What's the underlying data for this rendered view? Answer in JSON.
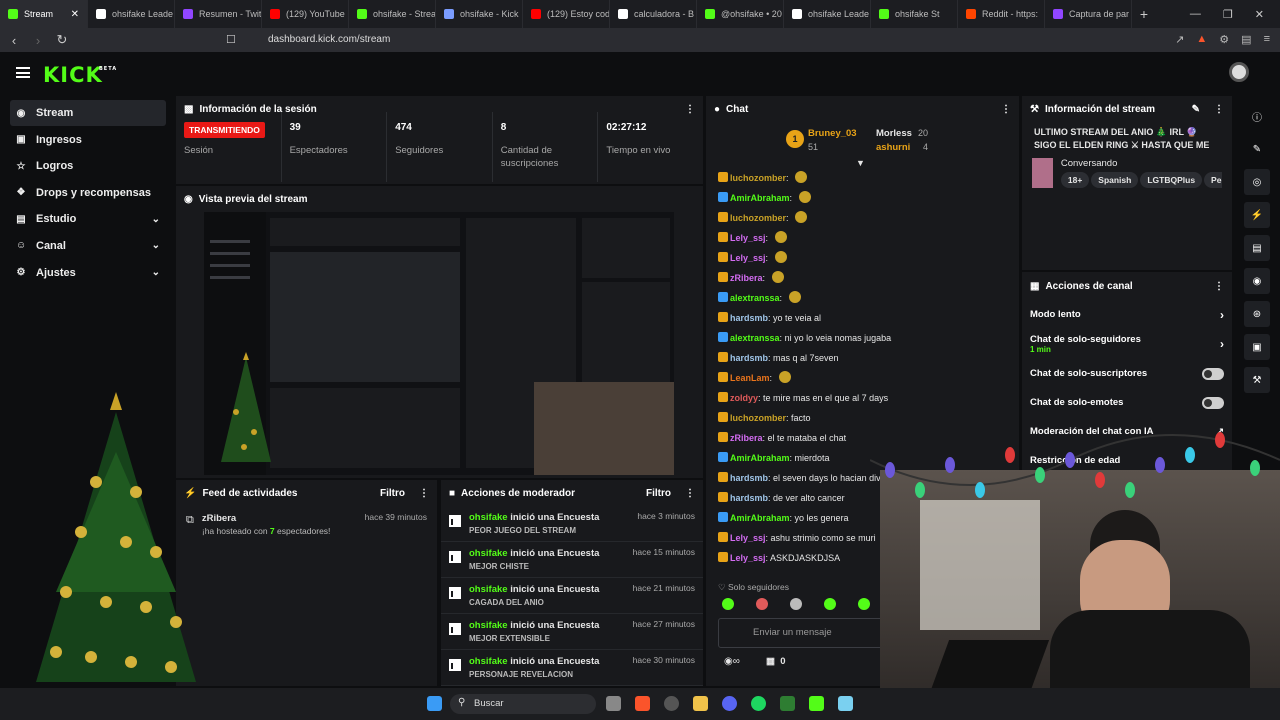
{
  "browser": {
    "tabs": [
      {
        "label": "Stream",
        "color": "#53fc18"
      },
      {
        "label": "ohsifake Leade",
        "color": "#ffffff"
      },
      {
        "label": "Resumen - Twit",
        "color": "#9146ff"
      },
      {
        "label": "(129) YouTube",
        "color": "#ff0000"
      },
      {
        "label": "ohsifake - Strea",
        "color": "#53fc18"
      },
      {
        "label": "ohsifake - Kick",
        "color": "#7a9cff"
      },
      {
        "label": "(129) Estoy cod",
        "color": "#ff0000"
      },
      {
        "label": "calculadora - B",
        "color": "#ffffff"
      },
      {
        "label": "@ohsifake • 20",
        "color": "#53fc18"
      },
      {
        "label": "ohsifake Leade",
        "color": "#ffffff"
      },
      {
        "label": "ohsifake St",
        "color": "#53fc18"
      },
      {
        "label": "Reddit - https:",
        "color": "#ff4500"
      },
      {
        "label": "Captura de par",
        "color": "#9146ff"
      }
    ],
    "url": "dashboard.kick.com/stream"
  },
  "brand": {
    "logo": "KICK",
    "beta": "BETA",
    "accent": "#53fc18"
  },
  "sidebar": {
    "items": [
      {
        "label": "Stream",
        "icon": "broadcast-icon"
      },
      {
        "label": "Ingresos",
        "icon": "money-icon"
      },
      {
        "label": "Logros",
        "icon": "trophy-icon"
      },
      {
        "label": "Drops y recompensas",
        "icon": "gift-icon"
      },
      {
        "label": "Estudio",
        "icon": "studio-icon"
      },
      {
        "label": "Canal",
        "icon": "user-icon"
      },
      {
        "label": "Ajustes",
        "icon": "gear-icon"
      }
    ]
  },
  "session": {
    "title": "Información de la sesión",
    "status": "TRANSMITIENDO",
    "status_label": "Sesión",
    "viewers": "39",
    "viewers_label": "Espectadores",
    "followers": "474",
    "followers_label": "Seguidores",
    "subs": "8",
    "subs_label": "Cantidad de suscripciones",
    "uptime": "02:27:12",
    "uptime_label": "Tiempo en vivo"
  },
  "preview": {
    "title": "Vista previa del stream"
  },
  "feed": {
    "title": "Feed de actividades",
    "filter": "Filtro",
    "user": "zRibera",
    "time": "hace 39 minutos",
    "msg_a": "¡ha hosteado con ",
    "msg_n": "7",
    "msg_b": " espectadores!"
  },
  "mod": {
    "title": "Acciones de moderador",
    "filter": "Filtro",
    "rows": [
      {
        "user": "ohsifake",
        "action": "inició una Encuesta",
        "sub": "PEOR JUEGO DEL STREAM",
        "time": "hace 3 minutos"
      },
      {
        "user": "ohsifake",
        "action": "inició una Encuesta",
        "sub": "MEJOR CHISTE",
        "time": "hace 15 minutos"
      },
      {
        "user": "ohsifake",
        "action": "inició una Encuesta",
        "sub": "CAGADA DEL ANIO",
        "time": "hace 21 minutos"
      },
      {
        "user": "ohsifake",
        "action": "inició una Encuesta",
        "sub": "MEJOR EXTENSIBLE",
        "time": "hace 27 minutos"
      },
      {
        "user": "ohsifake",
        "action": "inició una Encuesta",
        "sub": "PERSONAJE REVELACION",
        "time": "hace 30 minutos"
      }
    ]
  },
  "chat": {
    "title": "Chat",
    "top": [
      {
        "name": "Bruney_03",
        "count": "51",
        "rank": "1"
      },
      {
        "name": "Morless",
        "count": "20"
      },
      {
        "name": "ashurni",
        "count": "4"
      }
    ],
    "lines": [
      {
        "user": "luchozomber",
        "color": "#c9a227",
        "text": ""
      },
      {
        "user": "AmirAbraham",
        "color": "#53fc18",
        "text": ""
      },
      {
        "user": "luchozomber",
        "color": "#c9a227",
        "text": ""
      },
      {
        "user": "Lely_ssj",
        "color": "#d36cf2",
        "text": ""
      },
      {
        "user": "Lely_ssj",
        "color": "#d36cf2",
        "text": ""
      },
      {
        "user": "zRibera",
        "color": "#d36cf2",
        "text": ""
      },
      {
        "user": "alextranssa",
        "color": "#53fc18",
        "text": ""
      },
      {
        "user": "hardsmb",
        "color": "#9fc5e8",
        "text": "yo te veia al"
      },
      {
        "user": "alextranssa",
        "color": "#53fc18",
        "text": "ni yo lo veia nomas jugaba"
      },
      {
        "user": "hardsmb",
        "color": "#9fc5e8",
        "text": "mas q al 7seven"
      },
      {
        "user": "LeanLam",
        "color": "#e8741c",
        "text": ""
      },
      {
        "user": "zoldyy",
        "color": "#e05a5a",
        "text": "te mire mas en el        que al 7 days"
      },
      {
        "user": "luchozomber",
        "color": "#c9a227",
        "text": "facto"
      },
      {
        "user": "zRibera",
        "color": "#d36cf2",
        "text": "el        te mataba el chat"
      },
      {
        "user": "AmirAbraham",
        "color": "#53fc18",
        "text": "mierdota"
      },
      {
        "user": "hardsmb",
        "color": "#9fc5e8",
        "text": "el seven days lo hacian diver"
      },
      {
        "user": "hardsmb",
        "color": "#9fc5e8",
        "text": "de ver alto cancer"
      },
      {
        "user": "AmirAbraham",
        "color": "#53fc18",
        "text": "yo les genera"
      },
      {
        "user": "Lely_ssj",
        "color": "#d36cf2",
        "text": "ashu strimio como se muri"
      },
      {
        "user": "Lely_ssj",
        "color": "#d36cf2",
        "text": "ASKDJASKDJSA"
      }
    ],
    "followers_only": "Solo seguidores",
    "placeholder": "Enviar un mensaje",
    "gift_count": "0"
  },
  "streaminfo": {
    "title": "Información del stream",
    "stream_title": "ULTIMO STREAM DEL ANIO 🎄 IRL 🔮 SIGO EL ELDEN RING ⚔ HASTA QUE ME BAJE...",
    "category": "Conversando",
    "tags": [
      "18+",
      "Spanish",
      "LGTBQPlus",
      "Perú"
    ]
  },
  "channel": {
    "title": "Acciones de canal",
    "slow": "Modo lento",
    "followers_chat": "Chat de solo-seguidores",
    "followers_chat_sub": "1 min",
    "subs_chat": "Chat de solo-suscriptores",
    "emotes_chat": "Chat de solo-emotes",
    "ai_mod": "Moderación del chat con IA",
    "restrict": "Restricción de edad"
  },
  "taskbar": {
    "search": "Buscar"
  }
}
